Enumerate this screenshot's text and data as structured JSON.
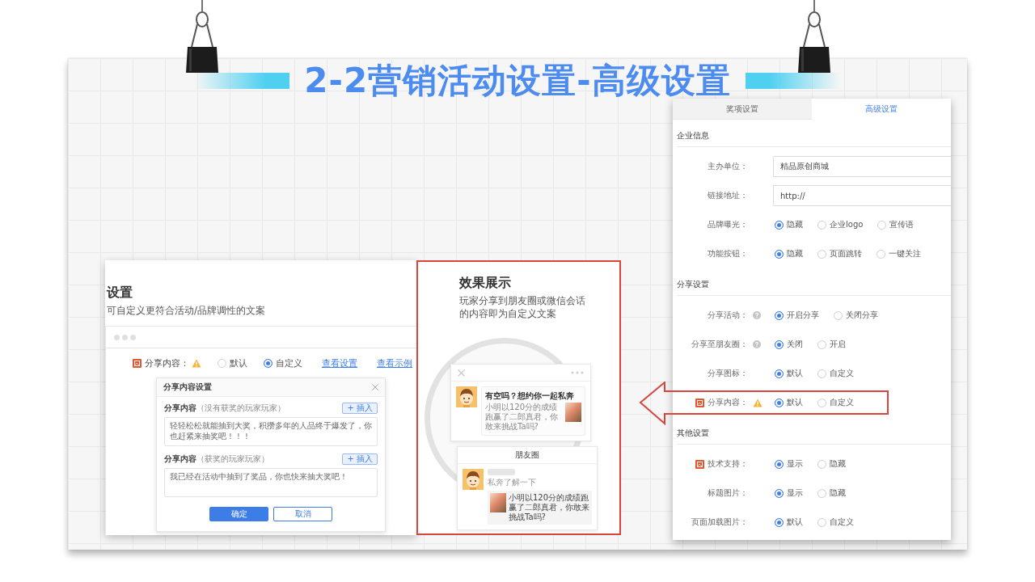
{
  "title": "2-2营销活动设置-高级设置",
  "left_panel": {
    "heading": "设置",
    "subtitle": "可自定义更符合活动/品牌调性的文案",
    "share_row": {
      "label": "分享内容：",
      "options": [
        {
          "label": "默认",
          "selected": false
        },
        {
          "label": "自定义",
          "selected": true
        }
      ],
      "links": [
        "查看设置",
        "查看示例"
      ]
    },
    "dialog": {
      "title": "分享内容设置",
      "fields": [
        {
          "label": "分享内容",
          "note": "（没有获奖的玩家玩家）",
          "button": "+ 插入",
          "value": "轻轻松松就能抽到大奖，积攒多年的人品终于爆发了，你也赶紧来抽奖吧！！！"
        },
        {
          "label": "分享内容",
          "note": "（获奖的玩家玩家）",
          "button": "+ 插入",
          "value": "我已经在活动中抽到了奖品，你也快来抽大奖吧！"
        }
      ],
      "buttons": [
        {
          "label": "确定",
          "kind": "primary"
        },
        {
          "label": "取消",
          "kind": "default"
        }
      ]
    }
  },
  "preview": {
    "heading": "效果展示",
    "subtitle": "玩家分享到朋友圈或微信会话的内容即为自定义文案",
    "chat_card": {
      "title": "有空吗？想约你一起私奔",
      "description": "小明以120分的成绩跑赢了二郎真君，你敢来挑战Ta吗?"
    },
    "moments_card": {
      "title": "朋友圈",
      "comment": "私奔了解一下",
      "link_text": "小明以120分的成绩跑赢了二郎真君，你敢来挑战Ta吗?"
    }
  },
  "settings_panel": {
    "tabs": [
      {
        "label": "奖项设置",
        "selected": false
      },
      {
        "label": "高级设置",
        "selected": true
      }
    ],
    "sections": [
      {
        "title": "企业信息",
        "rows": [
          {
            "kind": "input",
            "label": "主办单位：",
            "badge": false,
            "help": false,
            "warning": false,
            "value": "精品原创商城"
          },
          {
            "kind": "input",
            "label": "链接地址：",
            "badge": false,
            "help": false,
            "warning": false,
            "value": "http://"
          },
          {
            "kind": "radio",
            "label": "品牌曝光：",
            "badge": false,
            "help": false,
            "warning": false,
            "options": [
              {
                "label": "隐藏",
                "selected": true
              },
              {
                "label": "企业logo",
                "selected": false
              },
              {
                "label": "宣传语",
                "selected": false
              }
            ]
          },
          {
            "kind": "radio",
            "label": "功能按钮：",
            "badge": false,
            "help": false,
            "warning": false,
            "options": [
              {
                "label": "隐藏",
                "selected": true
              },
              {
                "label": "页面跳转",
                "selected": false
              },
              {
                "label": "一键关注",
                "selected": false
              }
            ]
          }
        ]
      },
      {
        "title": "分享设置",
        "rows": [
          {
            "kind": "radio",
            "label": "分享活动：",
            "badge": false,
            "help": true,
            "warning": false,
            "options": [
              {
                "label": "开启分享",
                "selected": true
              },
              {
                "label": "关闭分享",
                "selected": false
              }
            ]
          },
          {
            "kind": "radio",
            "label": "分享至朋友圈：",
            "badge": false,
            "help": true,
            "warning": false,
            "options": [
              {
                "label": "关闭",
                "selected": true
              },
              {
                "label": "开启",
                "selected": false
              }
            ]
          },
          {
            "kind": "radio",
            "label": "分享图标：",
            "badge": false,
            "help": false,
            "warning": false,
            "options": [
              {
                "label": "默认",
                "selected": true
              },
              {
                "label": "自定义",
                "selected": false
              }
            ]
          },
          {
            "kind": "radio",
            "label": "分享内容：",
            "badge": true,
            "help": false,
            "warning": true,
            "options": [
              {
                "label": "默认",
                "selected": true
              },
              {
                "label": "自定义",
                "selected": false
              }
            ]
          }
        ]
      },
      {
        "title": "其他设置",
        "rows": [
          {
            "kind": "radio",
            "label": "技术支持：",
            "badge": true,
            "help": false,
            "warning": false,
            "options": [
              {
                "label": "显示",
                "selected": true
              },
              {
                "label": "隐藏",
                "selected": false
              }
            ]
          },
          {
            "kind": "radio",
            "label": "标题图片：",
            "badge": false,
            "help": false,
            "warning": false,
            "options": [
              {
                "label": "显示",
                "selected": true
              },
              {
                "label": "隐藏",
                "selected": false
              }
            ]
          },
          {
            "kind": "radio",
            "label": "页面加载图片：",
            "badge": false,
            "help": false,
            "warning": false,
            "options": [
              {
                "label": "默认",
                "selected": true
              },
              {
                "label": "自定义",
                "selected": false
              }
            ]
          }
        ]
      }
    ]
  }
}
